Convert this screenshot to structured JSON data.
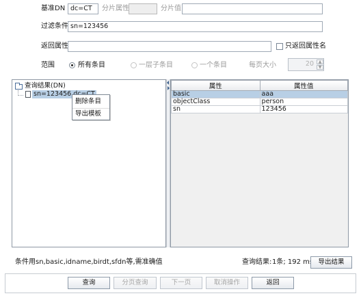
{
  "form": {
    "base_dn_label": "基准DN",
    "base_dn_value": "dc=CT",
    "shard_attr_label": "分片属性",
    "shard_attr_value": "",
    "shard_value_label": "分片值",
    "shard_value_value": "",
    "filter_label": "过滤条件",
    "filter_value": "sn=123456",
    "return_attrs_label": "返回属性",
    "return_attrs_value": "",
    "only_attr_names_label": "只返回属性名",
    "only_attr_names_checked": false,
    "scope_label": "范围",
    "scope_options": [
      "所有条目",
      "一层子条目",
      "一个条目"
    ],
    "scope_selected": "所有条目",
    "page_size_label": "每页大小",
    "page_size_value": "20"
  },
  "tree": {
    "root_label": "查询结果(DN)",
    "child_label": "sn=123456,dc=CT"
  },
  "context_menu": {
    "items": [
      "删除条目",
      "导出模板"
    ]
  },
  "attr_table": {
    "headers": [
      "属性",
      "属性值"
    ],
    "rows": [
      [
        "basic",
        "aaa"
      ],
      [
        "objectClass",
        "person"
      ],
      [
        "sn",
        "123456"
      ]
    ],
    "selected_row": 0
  },
  "status": {
    "hint": "条件用sn,basic,idname,birdt,sfdn等,需准确值",
    "result_label": "查询结果:",
    "result_value": "1条; 192 ms",
    "export_button": "导出结果"
  },
  "buttons": {
    "query": "查询",
    "page_query": "分页查询",
    "next_page": "下一页",
    "cancel": "取消操作",
    "back": "返回"
  },
  "colors": {
    "selection": "#b8cfe5",
    "border": "#8e98a4",
    "disabled_text": "#9a9a9a"
  }
}
